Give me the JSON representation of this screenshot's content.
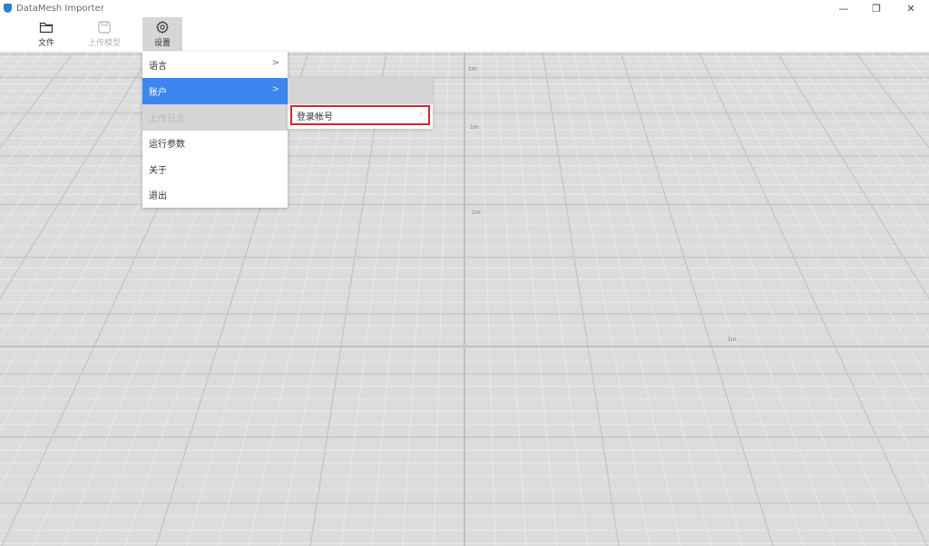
{
  "window": {
    "title": "DataMesh Importer",
    "controls": {
      "minimize": "—",
      "restore": "❐",
      "close": "✕"
    }
  },
  "toolbar": {
    "items": [
      {
        "label": "文件",
        "icon": "folder-icon",
        "enabled": true
      },
      {
        "label": "上传模型",
        "icon": "save-icon",
        "enabled": false
      },
      {
        "label": "设置",
        "icon": "gear-icon",
        "enabled": true,
        "active": true
      }
    ]
  },
  "settings_menu": {
    "items": [
      {
        "label": "语言",
        "has_submenu": true,
        "chevron": ">"
      },
      {
        "label": "账户",
        "has_submenu": true,
        "chevron": ">",
        "highlighted": true
      },
      {
        "label": "上传日志",
        "disabled": true
      },
      {
        "label": "运行参数"
      },
      {
        "label": "关于"
      },
      {
        "label": "退出"
      }
    ]
  },
  "account_submenu": {
    "items": [
      {
        "label": "登录帐号",
        "chevron": "›"
      }
    ]
  },
  "viewport": {
    "axis_labels": [
      "1m",
      "1m",
      "1m",
      "1m"
    ]
  },
  "colors": {
    "highlight": "#3d86f0",
    "focus_outline": "#d9232a",
    "canvas": "#dcdcdc"
  }
}
